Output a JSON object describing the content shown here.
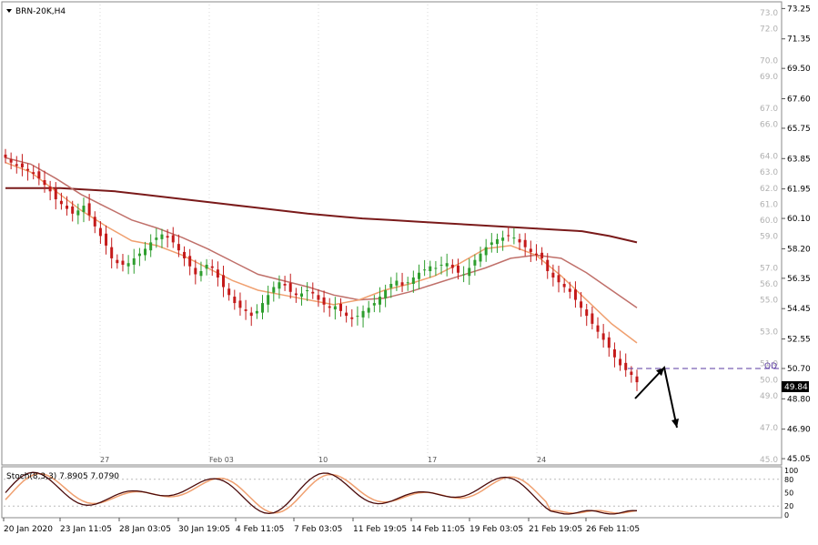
{
  "header": {
    "dropdown_icon": "triangle-down-icon",
    "title": "BRN-20K,H4"
  },
  "colors": {
    "background": "#ffffff",
    "bull_candle": "#2e9e2e",
    "bear_candle": "#c41a1a",
    "ema_fast": "#f0a070",
    "ema_mid": "#c0706a",
    "ma_slow": "#7a1a1a",
    "stoch_main": "#4a0a0a",
    "stoch_signal": "#f0a070",
    "od_line": "#5a3aa0",
    "grid": "#c8c8c8",
    "border": "#888888",
    "arrow": "#000000"
  },
  "price_panel": {
    "current_price": "49.84",
    "od_label": "OD",
    "od_price_label": "50.70",
    "scale_labels": [
      "73.25",
      "71.35",
      "69.50",
      "67.60",
      "65.75",
      "63.85",
      "61.95",
      "60.10",
      "58.20",
      "56.35",
      "54.45",
      "52.55",
      "50.70",
      "48.80",
      "46.90",
      "45.05"
    ],
    "minor_labels": [
      "73.0",
      "72.0",
      "70.0",
      "69.0",
      "67.0",
      "66.0",
      "64.0",
      "63.0",
      "62.0",
      "61.0",
      "60.0",
      "59.0",
      "57.0",
      "56.0",
      "55.0",
      "53.0",
      "51.0",
      "50.0",
      "49.0",
      "47.0",
      "45.0"
    ],
    "inline_date_labels": [
      "27",
      "Feb 03",
      "10",
      "17",
      "24"
    ]
  },
  "stoch_panel": {
    "title": "Stoch(8,3,3) 7.8905 7.0790",
    "scale_labels": [
      "100",
      "80",
      "50",
      "20",
      "0"
    ]
  },
  "time_axis": {
    "labels": [
      "20 Jan 2020",
      "23 Jan 11:05",
      "28 Jan 03:05",
      "30 Jan 19:05",
      "4 Feb 11:05",
      "7 Feb 03:05",
      "11 Feb 19:05",
      "14 Feb 11:05",
      "19 Feb 03:05",
      "21 Feb 19:05",
      "26 Feb 11:05"
    ]
  },
  "chart_data": {
    "type": "candlestick",
    "symbol": "BRN-20K",
    "timeframe": "H4",
    "y_range": [
      45.0,
      73.5
    ],
    "closes": [
      63.9,
      63.6,
      63.4,
      63.3,
      63.1,
      62.9,
      62.6,
      62.2,
      61.8,
      61.3,
      61.0,
      60.7,
      60.4,
      60.6,
      60.9,
      60.3,
      59.6,
      59.0,
      58.4,
      57.6,
      57.3,
      57.2,
      57.3,
      57.6,
      57.9,
      58.2,
      58.6,
      58.9,
      59.1,
      58.9,
      58.6,
      58.1,
      57.6,
      57.1,
      56.6,
      56.8,
      57.2,
      57.0,
      56.4,
      55.8,
      55.3,
      54.8,
      54.5,
      54.3,
      54.0,
      54.3,
      54.8,
      55.3,
      55.8,
      56.1,
      55.9,
      55.5,
      55.3,
      55.4,
      55.6,
      55.4,
      55.0,
      54.7,
      54.5,
      54.6,
      54.3,
      54.0,
      53.8,
      54.0,
      54.3,
      54.5,
      54.8,
      55.2,
      55.6,
      56.0,
      56.2,
      55.9,
      56.1,
      56.4,
      56.7,
      56.9,
      57.1,
      57.0,
      57.2,
      57.3,
      57.0,
      56.7,
      56.6,
      57.0,
      57.5,
      57.9,
      58.3,
      58.6,
      58.8,
      58.9,
      59.0,
      58.9,
      58.6,
      58.3,
      58.0,
      57.8,
      57.6,
      56.8,
      56.4,
      56.1,
      55.8,
      55.5,
      55.0,
      54.5,
      54.0,
      53.5,
      53.0,
      52.5,
      52.0,
      51.4,
      50.9,
      50.6,
      50.3,
      49.84
    ],
    "ma_slow": [
      62.0,
      62.0,
      62.0,
      61.9,
      61.8,
      61.6,
      61.4,
      61.2,
      61.0,
      60.8,
      60.6,
      60.4,
      60.25,
      60.1,
      60.0,
      59.9,
      59.8,
      59.7,
      59.6,
      59.5,
      59.4,
      59.3,
      59.0,
      58.6
    ],
    "ema_mid": [
      63.9,
      63.5,
      62.6,
      61.6,
      60.8,
      60.0,
      59.5,
      58.9,
      58.2,
      57.4,
      56.6,
      56.2,
      55.8,
      55.3,
      55.0,
      55.1,
      55.5,
      56.0,
      56.5,
      57.0,
      57.6,
      57.8,
      57.6,
      56.7,
      55.6,
      54.5
    ],
    "ema_fast": [
      63.6,
      63.0,
      61.8,
      60.6,
      59.6,
      58.7,
      58.4,
      57.8,
      57.0,
      56.2,
      55.6,
      55.3,
      55.0,
      54.7,
      55.0,
      55.6,
      56.0,
      56.5,
      57.3,
      58.2,
      58.4,
      57.8,
      56.5,
      55.0,
      53.5,
      52.3
    ],
    "od_level": 50.7,
    "stochastic": {
      "params": "8,3,3",
      "main": 7.8905,
      "signal": 7.079,
      "ylim": [
        0,
        100
      ],
      "levels": [
        20,
        80
      ]
    }
  }
}
